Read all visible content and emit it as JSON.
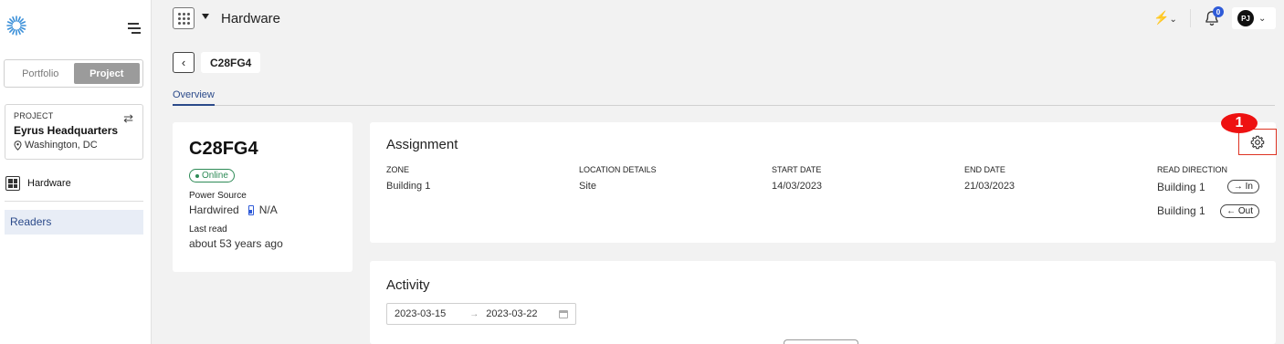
{
  "app": {
    "title": "Hardware"
  },
  "sidebar": {
    "mode_tabs": [
      {
        "label": "Portfolio",
        "active": false
      },
      {
        "label": "Project",
        "active": true
      }
    ],
    "project": {
      "kicker": "PROJECT",
      "name": "Eyrus Headquarters",
      "location": "Washington, DC"
    },
    "hardware_label": "Hardware",
    "readers_label": "Readers"
  },
  "topbar": {
    "notification_count": "0",
    "avatar_initials": "PJ"
  },
  "breadcrumb": {
    "device_id": "C28FG4"
  },
  "tabs": [
    {
      "label": "Overview",
      "active": true
    }
  ],
  "device": {
    "name": "C28FG4",
    "status": "Online",
    "power_source_label": "Power Source",
    "power_source_value": "Hardwired",
    "battery_value": "N/A",
    "last_read_label": "Last read",
    "last_read_value": "about 53 years ago"
  },
  "assignment": {
    "title": "Assignment",
    "columns": {
      "zone": {
        "head": "ZONE",
        "value": "Building 1"
      },
      "location": {
        "head": "LOCATION DETAILS",
        "value": "Site"
      },
      "start": {
        "head": "START DATE",
        "value": "14/03/2023"
      },
      "end": {
        "head": "END DATE",
        "value": "21/03/2023"
      },
      "direction": {
        "head": "READ DIRECTION"
      }
    },
    "directions": [
      {
        "label": "Building 1",
        "badge": "→ In"
      },
      {
        "label": "Building 1",
        "badge": "← Out"
      }
    ],
    "marker": "1"
  },
  "activity": {
    "title": "Activity",
    "start_date": "2023-03-15",
    "end_date": "2023-03-22",
    "separator": "→"
  },
  "colors": {
    "accent": "#2b4a8a",
    "online": "#2e8b57",
    "badge": "#2f5bd8",
    "highlight": "#dd2222"
  },
  "icons": [
    "logo-icon",
    "menu-icon",
    "swap-icon",
    "location-pin-icon",
    "qr-icon",
    "apps-grid-icon",
    "chevron-down-icon",
    "bolt-icon",
    "bell-icon",
    "back-chevron-icon",
    "battery-icon",
    "gear-icon",
    "calendar-icon"
  ]
}
